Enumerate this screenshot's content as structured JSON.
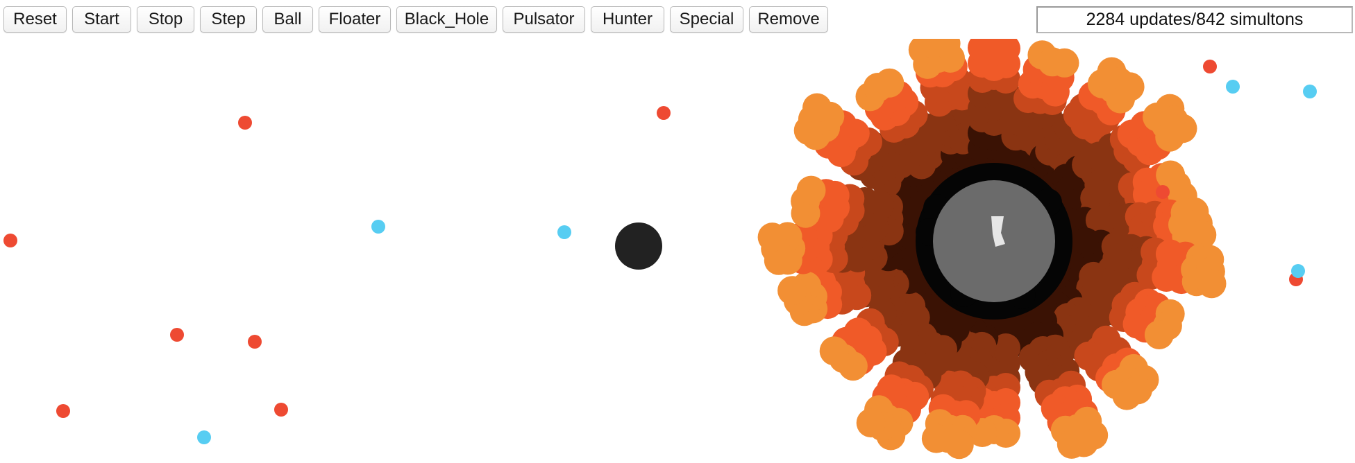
{
  "toolbar": {
    "buttons": [
      {
        "key": "reset",
        "label": "Reset"
      },
      {
        "key": "start",
        "label": "Start"
      },
      {
        "key": "stop",
        "label": "Stop"
      },
      {
        "key": "step",
        "label": "Step"
      },
      {
        "key": "ball",
        "label": "Ball"
      },
      {
        "key": "floater",
        "label": "Floater"
      },
      {
        "key": "black_hole",
        "label": "Black_Hole"
      },
      {
        "key": "pulsator",
        "label": "Pulsator"
      },
      {
        "key": "hunter",
        "label": "Hunter"
      },
      {
        "key": "special",
        "label": "Special"
      },
      {
        "key": "remove",
        "label": "Remove"
      }
    ],
    "status_text": "2284 updates/842 simultons"
  },
  "colors": {
    "ball": "#ee4a32",
    "floater": "#57cdf2",
    "black_hole": "#222222",
    "pulsator_core": "#6b6b6b",
    "pulsator_ring": "#050505",
    "swarm_dark": "#3a1204",
    "swarm_mid": "#8a3412",
    "swarm_bright": "#c8481c",
    "swarm_orange": "#f05a28",
    "swarm_light": "#f28f34"
  },
  "simultons": {
    "types": [
      "ball",
      "floater",
      "black_hole",
      "pulsator",
      "special"
    ]
  }
}
